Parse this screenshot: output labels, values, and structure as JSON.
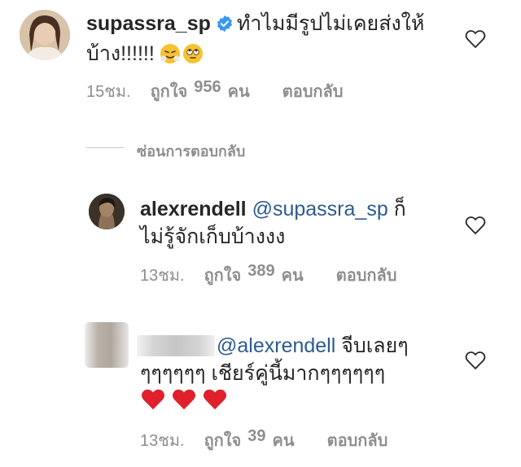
{
  "comment1": {
    "username": "supassra_sp",
    "text_line1": "ทำไมมีรูปไม่เคยส่งให้",
    "text_line2": "บ้าง!!!!!!",
    "emojis": [
      "face-with-steam-icon",
      "rolling-eyes-icon"
    ],
    "time": "15ชม.",
    "likes_label": "ถูกใจ",
    "likes_count": "956",
    "likes_unit": "คน",
    "reply_label": "ตอบกลับ"
  },
  "hide_replies_label": "ซ่อนการตอบกลับ",
  "reply1": {
    "username": "alexrendell",
    "mention": "@supassra_sp",
    "text_inline": " ก็",
    "text_line2": "ไม่รู้จักเก็บบ้างงง",
    "time": "13ชม.",
    "likes_label": "ถูกใจ",
    "likes_count": "389",
    "likes_unit": "คน",
    "reply_label": "ตอบกลับ"
  },
  "reply2": {
    "mention": "@alexrendell",
    "text_inline": " จีบเลยๆ",
    "text_line2": "ๆๆๆๆๆๆ เชียร์คู่นี้มากๆๆๆๆๆๆ",
    "emojis": [
      "red-heart-icon",
      "red-heart-icon",
      "red-heart-icon"
    ],
    "time": "13ชม.",
    "likes_label": "ถูกใจ",
    "likes_count": "39",
    "likes_unit": "คน",
    "reply_label": "ตอบกลับ"
  },
  "colors": {
    "text": "#262626",
    "meta": "#8e8e8e",
    "mention": "#2c5b8e",
    "verified": "#3897f0",
    "heart_red": "#e0202c"
  }
}
